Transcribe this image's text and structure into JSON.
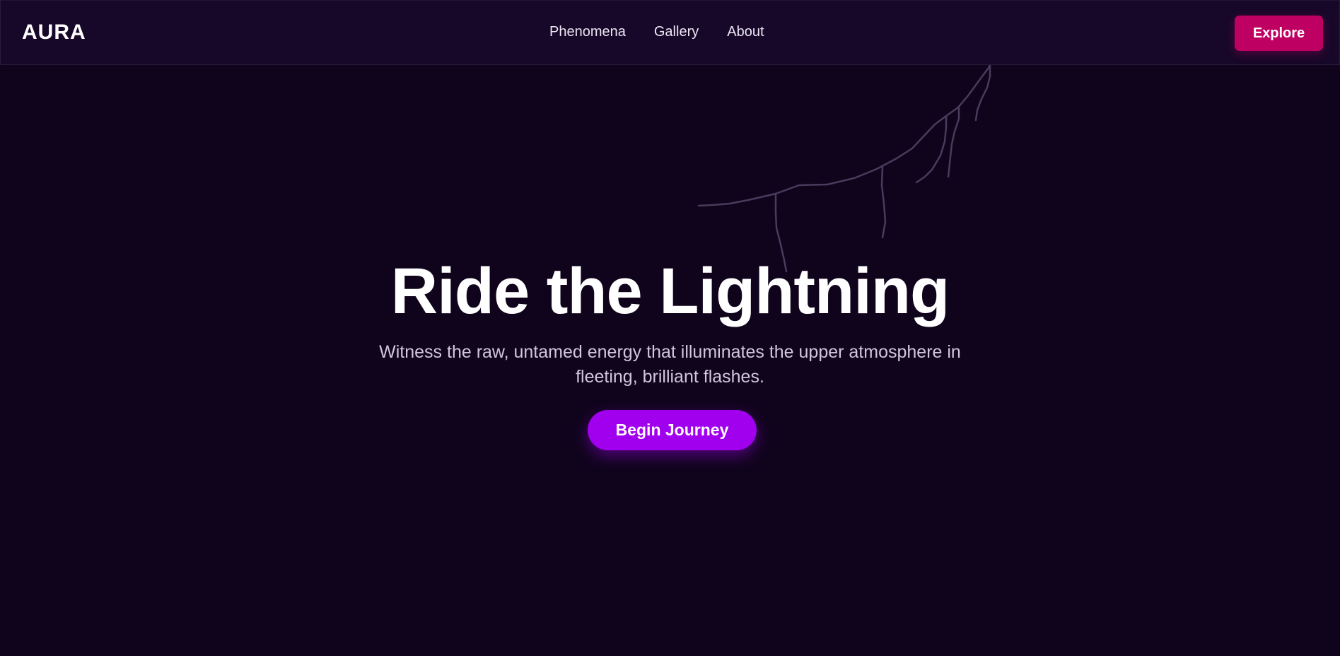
{
  "header": {
    "brand": "AURA",
    "nav": [
      {
        "label": "Phenomena"
      },
      {
        "label": "Gallery"
      },
      {
        "label": "About"
      }
    ],
    "cta_label": "Explore"
  },
  "hero": {
    "title": "Ride the Lightning",
    "subtitle": "Witness the raw, untamed energy that illuminates the upper atmosphere in fleeting, brilliant flashes.",
    "cta_label": "Begin Journey"
  },
  "decor": {
    "lightning": "lightning-bolt-illustration"
  },
  "colors": {
    "background": "#10041c",
    "navbar": "#170729",
    "explore_button": "#bf0063",
    "primary_button": "#a000ee",
    "subtitle_text": "#cfc6dd"
  }
}
